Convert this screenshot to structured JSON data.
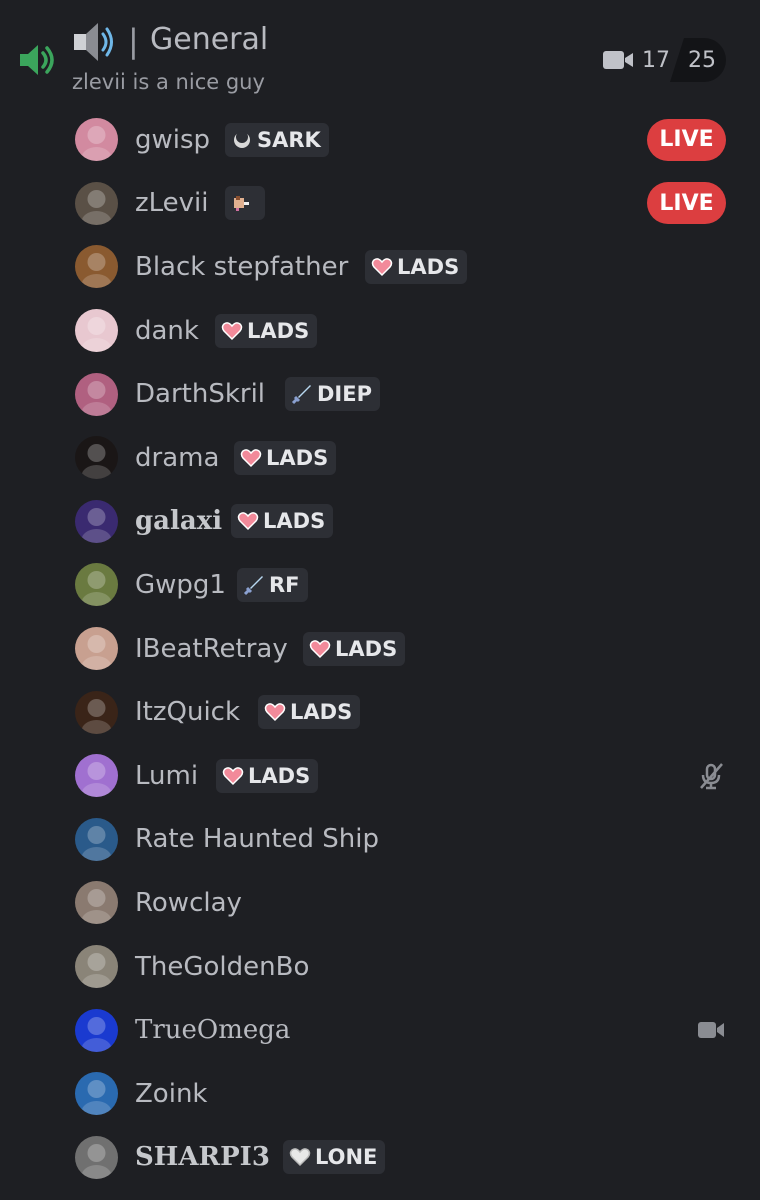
{
  "channel": {
    "name": "General",
    "separator": "|",
    "status": "zlevii is a nice guy",
    "video_count": "17",
    "video_limit": "25"
  },
  "members": [
    {
      "name": "gwisp",
      "tag": "SARK",
      "tag_icon": "moon-icon",
      "live": "LIVE",
      "avatar": "#d28aa0"
    },
    {
      "name": "zLevii",
      "tag": "",
      "tag_icon": "pixel-dog-icon",
      "live": "LIVE",
      "avatar": "#5a5046"
    },
    {
      "name": "Black stepfather",
      "tag": "LADS",
      "tag_icon": "heart-icon",
      "avatar": "#8a5a30"
    },
    {
      "name": "dank",
      "tag": "LADS",
      "tag_icon": "heart-icon",
      "avatar": "#e8c8d0"
    },
    {
      "name": "DarthSkril",
      "tag": "DIEP",
      "tag_icon": "sword-icon",
      "avatar": "#b06080"
    },
    {
      "name": "drama",
      "tag": "LADS",
      "tag_icon": "heart-icon",
      "avatar": "#1a1616"
    },
    {
      "name": "galaxi",
      "tag": "LADS",
      "tag_icon": "heart-icon",
      "avatar": "#3a2a70"
    },
    {
      "name": "Gwpg1",
      "tag": "RF",
      "tag_icon": "sword-icon",
      "avatar": "#6a7a40"
    },
    {
      "name": "IBeatRetray",
      "tag": "LADS",
      "tag_icon": "heart-icon",
      "avatar": "#c8a090"
    },
    {
      "name": "ItzQuick",
      "tag": "LADS",
      "tag_icon": "heart-icon",
      "avatar": "#3a2418"
    },
    {
      "name": "Lumi",
      "tag": "LADS",
      "tag_icon": "heart-icon",
      "right": "muted-mic-icon",
      "avatar": "#a070d0"
    },
    {
      "name": "Rate Haunted Ship",
      "tag": "",
      "avatar": "#2a5a8a"
    },
    {
      "name": "Rowclay",
      "tag": "",
      "avatar": "#8a7a70"
    },
    {
      "name": "TheGoldenBo",
      "tag": "",
      "avatar": "#8a8478"
    },
    {
      "name": "TrueOmega",
      "tag": "",
      "right": "video-camera-icon",
      "avatar": "#1a3ad0"
    },
    {
      "name": "Zoink",
      "tag": "",
      "avatar": "#2a6ab0"
    },
    {
      "name": "SHARPI3",
      "tag": "LONE",
      "tag_icon": "white-heart-icon",
      "avatar": "#707070"
    }
  ],
  "colors": {
    "background": "#1e1f23",
    "live_badge": "#dc3e40",
    "tag_bg": "#2d2f35",
    "speaker_green": "#3ba55c"
  }
}
